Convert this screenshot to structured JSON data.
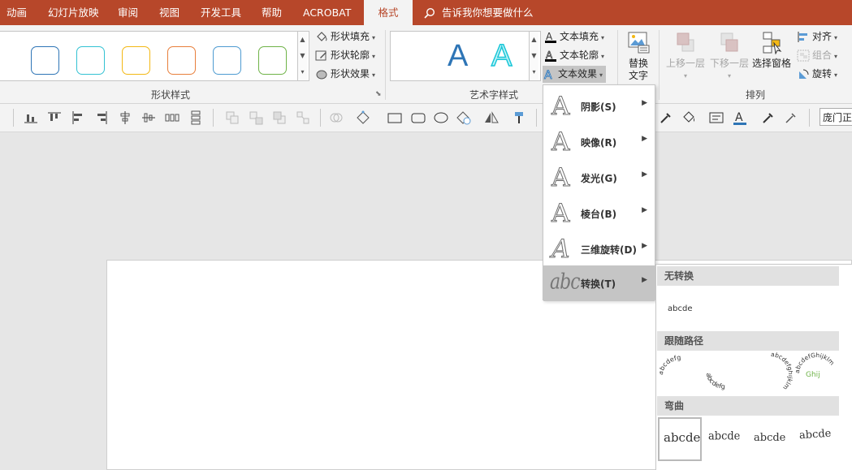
{
  "tabs": [
    {
      "label": "动画",
      "active": false
    },
    {
      "label": "幻灯片放映",
      "active": false
    },
    {
      "label": "审阅",
      "active": false
    },
    {
      "label": "视图",
      "active": false
    },
    {
      "label": "开发工具",
      "active": false
    },
    {
      "label": "帮助",
      "active": false
    },
    {
      "label": "ACROBAT",
      "active": false
    },
    {
      "label": "格式",
      "active": true
    }
  ],
  "tell_me": "告诉我你想要做什么",
  "colors": {
    "accent": "#b7472a",
    "shape_styles": [
      "#2e75b6",
      "#33c2d3",
      "#f3b814",
      "#e87f3c",
      "#4e9bd1",
      "#6fb348"
    ]
  },
  "ribbon": {
    "shape_styles": {
      "group_label": "形状样式",
      "fill": "形状填充",
      "outline": "形状轮廓",
      "effects": "形状效果"
    },
    "wordart": {
      "group_label": "艺术字样式",
      "fill": "文本填充",
      "outline": "文本轮廓",
      "effects": "文本效果",
      "samples": [
        "A",
        "A"
      ]
    },
    "accessibility": {
      "alt_text_line1": "替换",
      "alt_text_line2": "文字"
    },
    "arrange": {
      "group_label": "排列",
      "bring_forward": "上移一层",
      "send_backward": "下移一层",
      "selection_pane": "选择窗格",
      "align": "对齐",
      "group": "组合",
      "rotate": "旋转"
    }
  },
  "font_name": "庞门正",
  "effects_menu": {
    "items": [
      {
        "label": "阴影(S)",
        "glyph": "A"
      },
      {
        "label": "映像(R)",
        "glyph": "A"
      },
      {
        "label": "发光(G)",
        "glyph": "A"
      },
      {
        "label": "棱台(B)",
        "glyph": "A"
      },
      {
        "label": "三维旋转(D)",
        "glyph": "A"
      },
      {
        "label": "转换(T)",
        "glyph": "abc"
      }
    ]
  },
  "transform_panel": {
    "no_transform": {
      "header": "无转换",
      "sample": "abcde"
    },
    "follow_path": {
      "header": "跟随路径",
      "arch_text": "abcdefg",
      "circle_text": "abcdefghijklm",
      "button_text": "abcdefGhijklm"
    },
    "warp": {
      "header": "弯曲",
      "samples": [
        "abcde",
        "abcde",
        "abcde",
        "abcde"
      ]
    }
  }
}
